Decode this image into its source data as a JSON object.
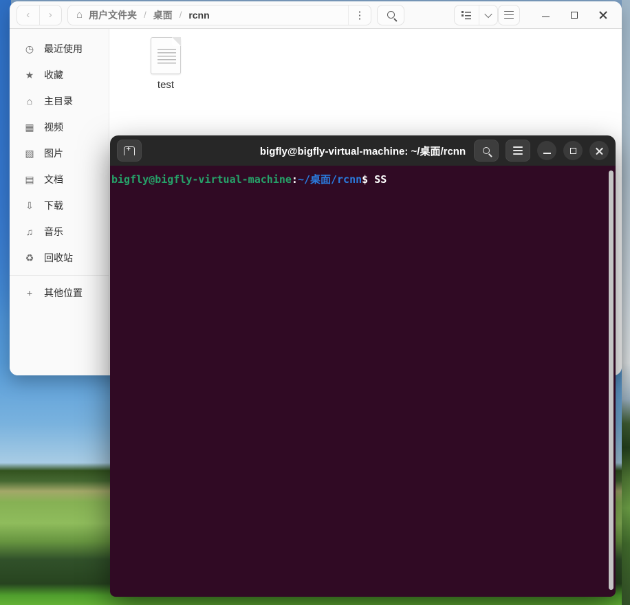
{
  "files_window": {
    "header": {
      "back_icon": "‹",
      "forward_icon": "›",
      "breadcrumb": {
        "home_icon": "⌂",
        "root_label": "用户文件夹",
        "sep1": "/",
        "crumb1": "桌面",
        "sep2": "/",
        "current": "rcnn",
        "kebab_icon": "⋮"
      }
    },
    "sidebar": {
      "items": [
        {
          "icon": "◷",
          "label": "最近使用"
        },
        {
          "icon": "★",
          "label": "收藏"
        },
        {
          "icon": "⌂",
          "label": "主目录"
        },
        {
          "icon": "▦",
          "label": "视频"
        },
        {
          "icon": "▧",
          "label": "图片"
        },
        {
          "icon": "▤",
          "label": "文档"
        },
        {
          "icon": "⇩",
          "label": "下载"
        },
        {
          "icon": "♫",
          "label": "音乐"
        },
        {
          "icon": "♻",
          "label": "回收站"
        }
      ],
      "other_locations": {
        "icon": "+",
        "label": "其他位置"
      }
    },
    "content": {
      "file_label": "test"
    }
  },
  "terminal_window": {
    "title": "bigfly@bigfly-virtual-machine: ~/桌面/rcnn",
    "prompt": {
      "user_host": "bigfly@bigfly-virtual-machine",
      "colon": ":",
      "path": "~/桌面/rcnn",
      "dollar": "$",
      "command": " SS"
    }
  },
  "colors": {
    "terminal_bg": "#300a24",
    "prompt_green": "#26a269",
    "prompt_blue": "#2a7bde",
    "titlebar_dark": "#272727",
    "files_header_bg": "#fafafa"
  }
}
